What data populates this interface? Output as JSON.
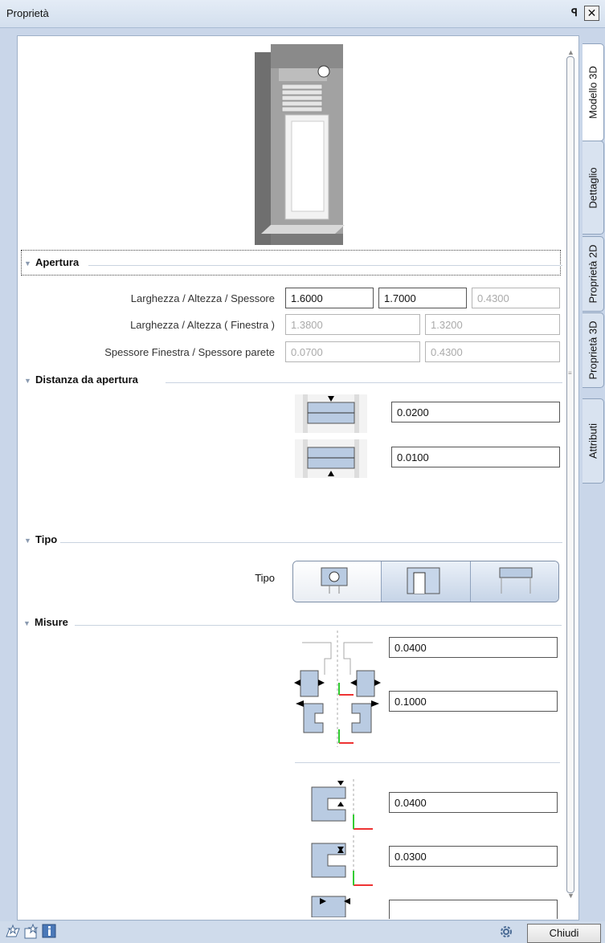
{
  "window": {
    "title": "Proprietà",
    "pin_icon": "pin-icon",
    "close_label": "✕"
  },
  "tabs": [
    {
      "label": "Modello 3D",
      "active": true
    },
    {
      "label": "Dettaglio",
      "active": false
    },
    {
      "label": "Proprietà 2D",
      "active": false
    },
    {
      "label": "Proprietà 3D",
      "active": false
    },
    {
      "label": "Attributi",
      "active": false
    }
  ],
  "sections": {
    "apertura": {
      "title": "Apertura",
      "rows": [
        {
          "label": "Larghezza / Altezza / Spessore",
          "values": [
            "1.6000",
            "1.7000",
            "0.4300"
          ]
        },
        {
          "label": "Larghezza / Altezza ( Finestra )",
          "values": [
            "1.3800",
            "1.3200"
          ]
        },
        {
          "label": "Spessore Finestra / Spessore parete",
          "values": [
            "0.0700",
            "0.4300"
          ]
        }
      ]
    },
    "distanza": {
      "title": "Distanza da apertura",
      "values": [
        "0.0200",
        "0.0100"
      ]
    },
    "tipo": {
      "title": "Tipo",
      "label": "Tipo"
    },
    "misure": {
      "title": "Misure",
      "values": [
        "0.0400",
        "0.1000",
        "0.0400",
        "0.0300"
      ]
    }
  },
  "footer": {
    "close_button": "Chiudi"
  },
  "colors": {
    "accent": "#c9d6e9",
    "panel": "#ffffff",
    "border": "#9fb1c8"
  }
}
